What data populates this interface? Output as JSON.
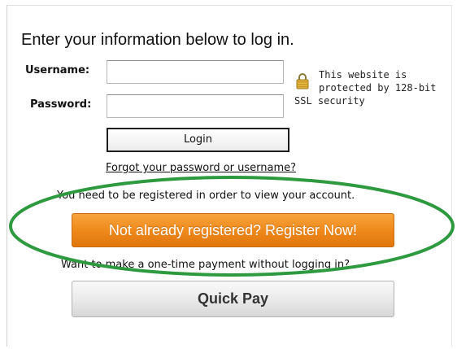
{
  "heading": "Enter your information below to log in.",
  "form": {
    "username_label": "Username:",
    "username_value": "",
    "password_label": "Password:",
    "password_value": "",
    "login_label": "Login",
    "forgot_link": "Forgot your password or username?"
  },
  "security_note": {
    "line1": "This website is",
    "line2": "protected by 128-bit",
    "line3": "SSL security",
    "icon": "lock-icon"
  },
  "registration": {
    "notice": "You need to be registered in order to view your account.",
    "register_button": "Not already registered? Register Now!"
  },
  "quick_payment": {
    "prompt": "Want to make a one-time payment without logging in?",
    "button": "Quick Pay"
  },
  "colors": {
    "register_button": "#ef8a1c",
    "highlight_ellipse": "#2e9a3f"
  }
}
